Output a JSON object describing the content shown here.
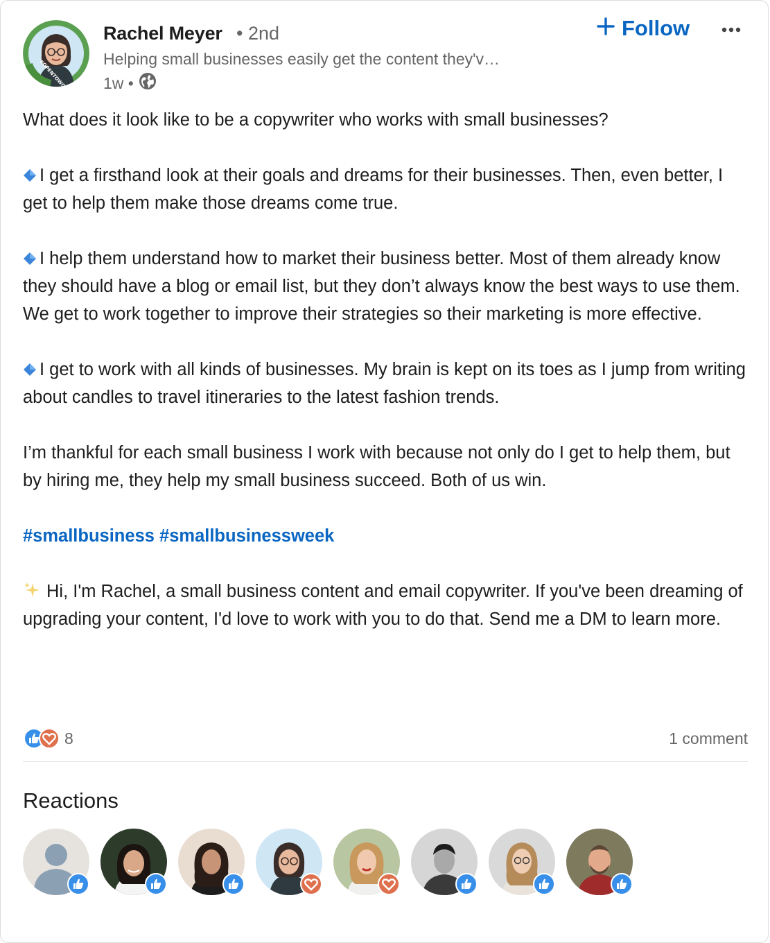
{
  "author": {
    "name": "Rachel Meyer",
    "degree": "• 2nd",
    "headline": "Helping small businesses easily get the content they'v…",
    "time": "1w •",
    "visibility_icon": "globe-icon"
  },
  "actions": {
    "follow_label": "Follow",
    "follow_icon": "plus-icon",
    "more_icon": "ellipsis-icon"
  },
  "post": {
    "intro": "What does it look like to be a copywriter who works with small businesses?",
    "bullets": [
      "I get a firsthand look at their goals and dreams for their businesses. Then, even better, I get to help them make those dreams come true.",
      "I help them understand how to market their business better. Most of them already know they should have a blog or email list, but they don’t always know the best ways to use them. We get to work together to improve their strategies so their marketing is more effective.",
      "I get to work with all kinds of businesses. My brain is kept on its toes as I jump from writing about candles to travel itineraries to the latest fashion trends."
    ],
    "thanks": "I’m thankful for each small business I work with because not only do I get to help them, but by hiring me, they help my small business succeed. Both of us win.",
    "hashtags": [
      "#smallbusiness",
      "#smallbusinessweek"
    ],
    "signature": "Hi, I'm Rachel, a small business content and email copywriter. If you've been dreaming of upgrading your content, I'd love to work with you to do that. Send me a DM to learn more."
  },
  "social": {
    "reaction_count": "8",
    "comment_count": "1 comment",
    "reaction_types": [
      "like",
      "love"
    ]
  },
  "reactions": {
    "title": "Reactions",
    "people": [
      {
        "kind": "placeholder",
        "reaction": "like"
      },
      {
        "kind": "photo",
        "reaction": "like"
      },
      {
        "kind": "photo",
        "reaction": "like"
      },
      {
        "kind": "photo",
        "reaction": "love"
      },
      {
        "kind": "photo",
        "reaction": "love"
      },
      {
        "kind": "photo",
        "reaction": "like"
      },
      {
        "kind": "photo",
        "reaction": "like"
      },
      {
        "kind": "photo",
        "reaction": "like"
      }
    ]
  },
  "colors": {
    "brand_blue": "#0a66c2",
    "like_blue": "#378fe9",
    "love_orange": "#df704d",
    "muted_text": "#666666"
  }
}
